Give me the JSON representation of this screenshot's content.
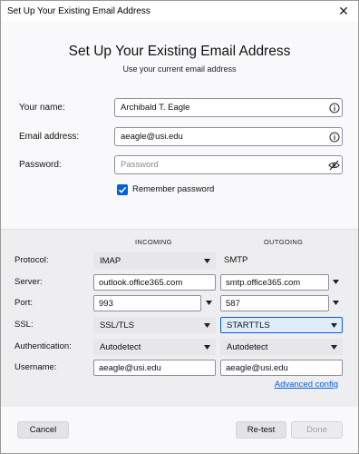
{
  "window": {
    "title": "Set Up Your Existing Email Address",
    "close_glyph": "✕"
  },
  "header": {
    "title": "Set Up Your Existing Email Address",
    "subtitle": "Use your current email address"
  },
  "form": {
    "name_label": "Your name:",
    "name_value": "Archibald T. Eagle",
    "email_label": "Email address:",
    "email_value": "aeagle@usi.edu",
    "password_label": "Password:",
    "password_value": "",
    "password_placeholder": "Password",
    "remember_label": "Remember password",
    "remember_checked": true,
    "icons": {
      "name_info": "info-icon",
      "email_info": "info-icon",
      "password_toggle": "eye-slash-icon"
    }
  },
  "server": {
    "incoming_header": "INCOMING",
    "outgoing_header": "OUTGOING",
    "labels": {
      "protocol": "Protocol:",
      "server": "Server:",
      "port": "Port:",
      "ssl": "SSL:",
      "authentication": "Authentication:",
      "username": "Username:"
    },
    "incoming": {
      "protocol": "IMAP",
      "server": "outlook.office365.com",
      "port": "993",
      "ssl": "SSL/TLS",
      "authentication": "Autodetect",
      "username": "aeagle@usi.edu"
    },
    "outgoing": {
      "protocol": "SMTP",
      "server": "smtp.office365.com",
      "port": "587",
      "ssl": "STARTTLS",
      "authentication": "Autodetect",
      "username": "aeagle@usi.edu"
    },
    "advanced_link": "Advanced config"
  },
  "buttons": {
    "cancel": "Cancel",
    "retest": "Re-test",
    "done": "Done"
  },
  "colors": {
    "accent": "#0061e0",
    "panel": "#eeeef0",
    "background": "#f9f9fb"
  }
}
